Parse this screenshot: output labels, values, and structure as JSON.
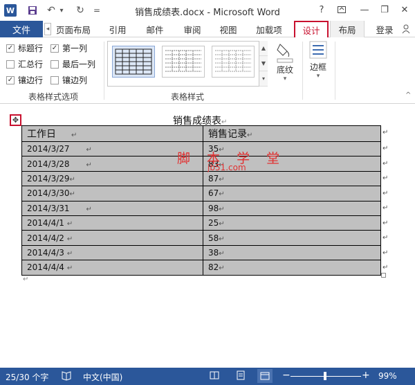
{
  "window": {
    "title": "销售成绩表.docx - Microsoft Word",
    "help": "?",
    "minimize": "—",
    "restore": "❐",
    "close": "✕"
  },
  "qat": {
    "app_icon": "W",
    "save": "💾",
    "undo": "↶",
    "undo_drop": "▾",
    "redo": "↻",
    "customize": "="
  },
  "tabs": {
    "file": "文件",
    "scroll_left": "◂",
    "items": [
      "页面布局",
      "引用",
      "邮件",
      "审阅",
      "视图",
      "加载项",
      "设计",
      "布局"
    ],
    "signin": "登录"
  },
  "style_options": {
    "group_label": "表格样式选项",
    "items": [
      {
        "label": "标题行",
        "checked": true
      },
      {
        "label": "第一列",
        "checked": true
      },
      {
        "label": "汇总行",
        "checked": false
      },
      {
        "label": "最后一列",
        "checked": false
      },
      {
        "label": "镶边行",
        "checked": true
      },
      {
        "label": "镶边列",
        "checked": false
      }
    ]
  },
  "table_styles": {
    "group_label": "表格样式",
    "scroll_up": "▲",
    "scroll_down": "▼",
    "more": "▾"
  },
  "shading": {
    "label": "底纹",
    "drop": "▾"
  },
  "borders": {
    "label": "边框",
    "drop": "▾"
  },
  "document": {
    "title": "销售成绩表",
    "para_mark": "↵",
    "move_handle": "✥",
    "headers": [
      "工作日",
      "销售记录"
    ],
    "rows": [
      [
        "2014/3/27",
        "35"
      ],
      [
        "2014/3/28",
        "83"
      ],
      [
        "2014/3/29",
        "87"
      ],
      [
        "2014/3/30",
        "67"
      ],
      [
        "2014/3/31",
        "98"
      ],
      [
        "2014/4/1",
        "25"
      ],
      [
        "2014/4/2",
        "58"
      ],
      [
        "2014/4/3",
        "38"
      ],
      [
        "2014/4/4",
        "82"
      ]
    ],
    "watermark": "脚 本 学 堂",
    "watermark_sub": "jb51.com"
  },
  "status": {
    "word_count": "25/30 个字",
    "proof_icon": "📖",
    "language": "中文(中国)",
    "zoom_minus": "−",
    "zoom_plus": "+",
    "zoom": "99%"
  },
  "colors": {
    "accent": "#2b579a",
    "highlight": "#c8102e",
    "table_fill": "#c0c0c0"
  }
}
